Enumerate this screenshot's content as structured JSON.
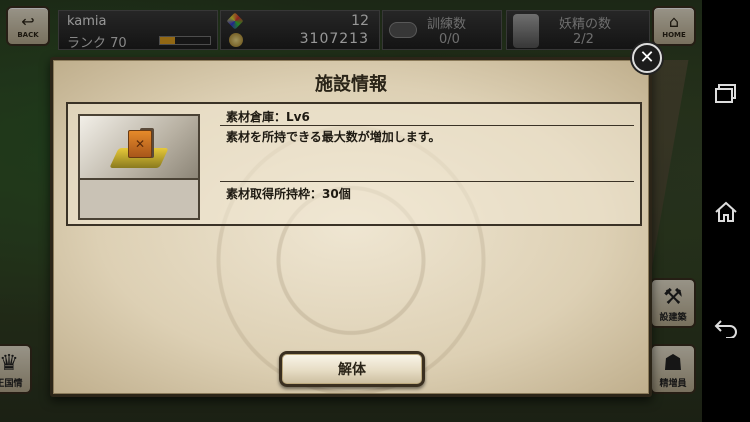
{
  "hud": {
    "back_label": "BACK",
    "home_label": "HOME",
    "player_name": "kamia",
    "rank_label": "ランク 70",
    "rank_progress": 0.3,
    "gems": "12",
    "coins": "3107213",
    "training_label": "訓練数",
    "training_value": "0/0",
    "fairy_label": "妖精の数",
    "fairy_value": "2/2"
  },
  "side_buttons": {
    "kingdom_label": "王国情",
    "build_label": "設建築",
    "fairy_add_label": "精増員"
  },
  "dialog": {
    "title": "施設情報",
    "close_symbol": "✕",
    "facility_name": "素材倉庫：Lv6",
    "description": "素材を所持できる最大数が増加します。",
    "capacity": "素材取得所持枠：30個",
    "dismantle_label": "解体"
  },
  "icons": {
    "back": "arrow-back-icon",
    "home": "home-icon",
    "gem": "gem-icon",
    "coin": "coin-icon",
    "whistle": "whistle-icon",
    "fairy": "fairy-icon",
    "close": "close-icon"
  },
  "colors": {
    "dialog_bg": "#e8dec8",
    "rank_bar": "#e0a020"
  }
}
